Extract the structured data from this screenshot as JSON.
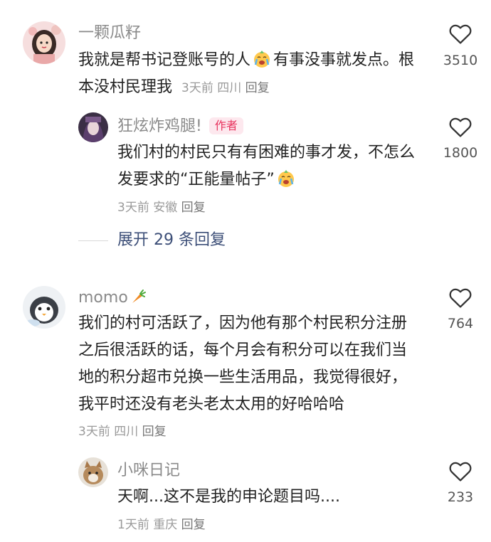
{
  "comments": [
    {
      "author": "一颗瓜籽",
      "text_before_emoji": "我就是帮书记登账号的人",
      "text_after_emoji": "有事没事就发点。根本没村民理我",
      "time": "3天前",
      "location": "四川",
      "reply_label": "回复",
      "likes": "3510",
      "reply": {
        "author": "狂炫炸鸡腿!",
        "author_tag": "作者",
        "text": "我们村的村民只有有困难的事才发，不怎么发要求的“正能量帖子”",
        "time": "3天前",
        "location": "安徽",
        "reply_label": "回复",
        "likes": "1800"
      },
      "expand_label": "展开 29 条回复"
    },
    {
      "author": "momo",
      "text": "我们的村可活跃了，因为他有那个村民积分注册之后很活跃的话，每个月会有积分可以在我们当地的积分超市兑换一些生活用品，我觉得很好，我平时还没有老头老太太用的好哈哈哈",
      "time": "3天前",
      "location": "四川",
      "reply_label": "回复",
      "likes": "764",
      "reply": {
        "author": "小咪日记",
        "text": "天啊...这不是我的申论题目吗....",
        "time": "1天前",
        "location": "重庆",
        "reply_label": "回复",
        "likes": "233"
      }
    }
  ],
  "icons": {
    "like": "heart-outline-icon",
    "emoji": "crying-face-emoji",
    "carrot": "carrot-emoji"
  }
}
